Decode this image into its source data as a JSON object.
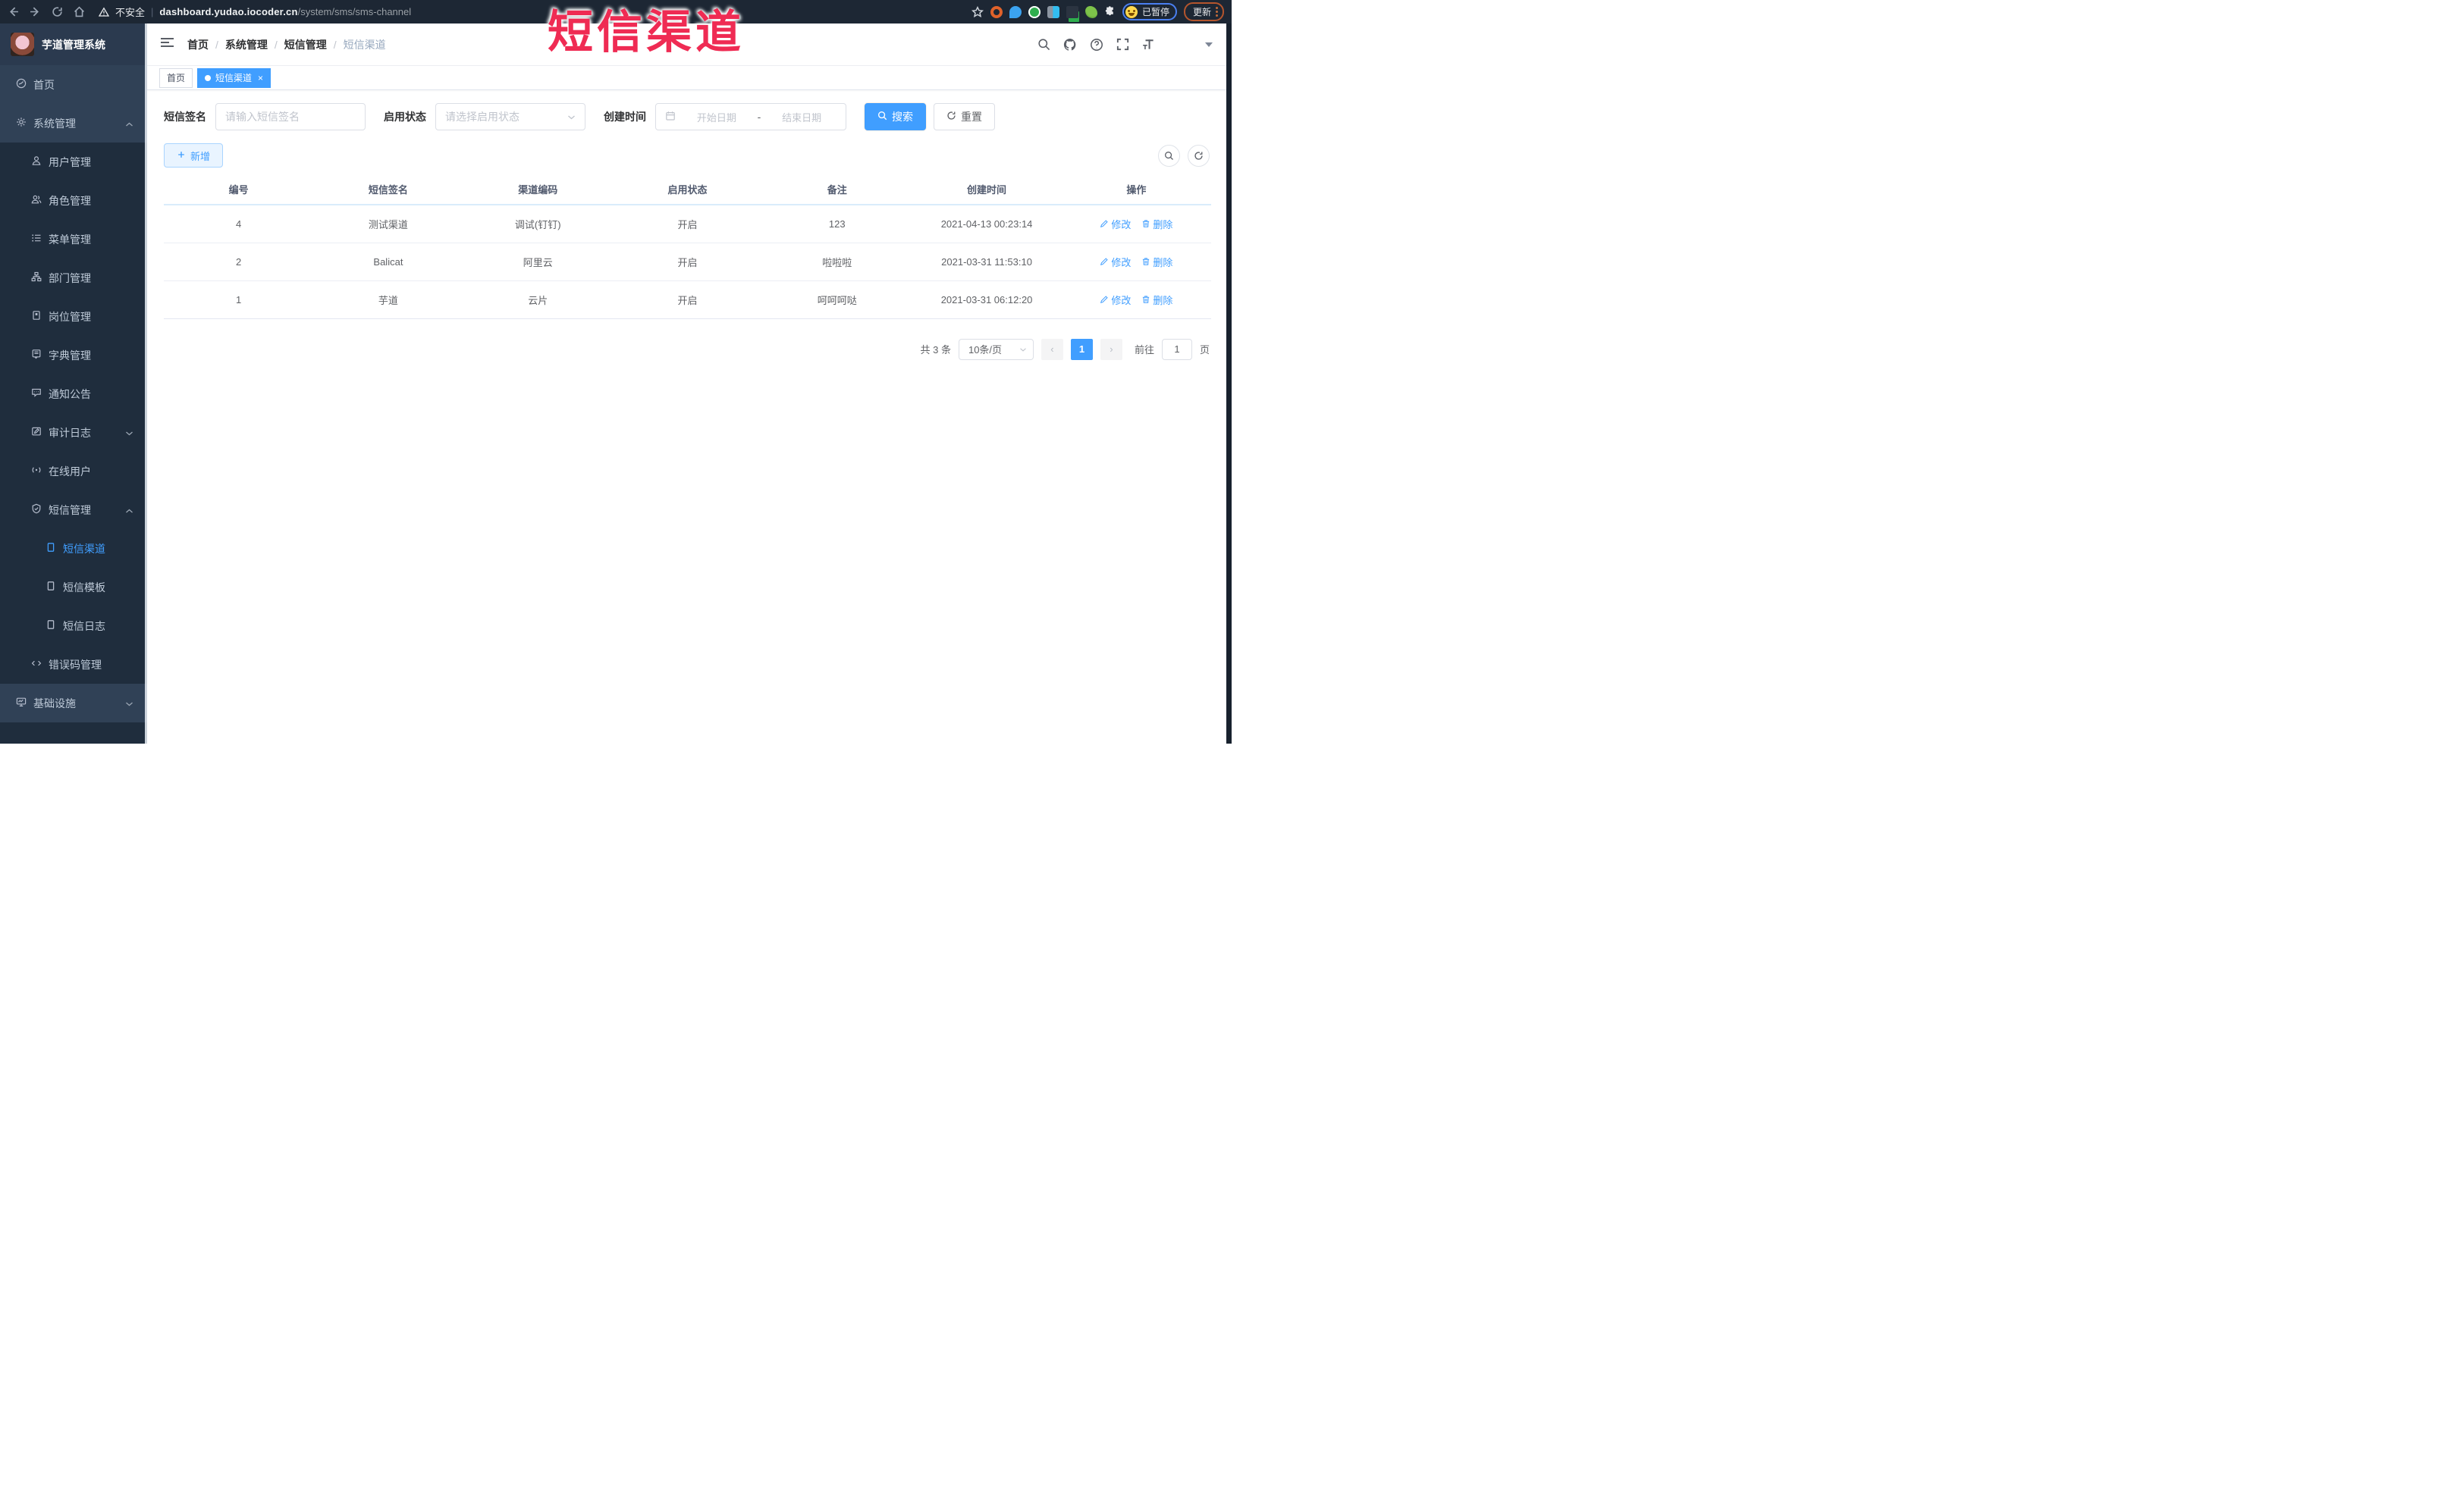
{
  "browser": {
    "security_label": "不安全",
    "url_domain": "dashboard.yudao.iocoder.cn",
    "url_path": "/system/sms/sms-channel",
    "profile_status": "已暂停",
    "update_label": "更新"
  },
  "overlay": {
    "text": "短信渠道",
    "color": "#ef2b53"
  },
  "sidebar": {
    "logo_title": "芋道管理系统",
    "menu": {
      "home": "首页",
      "system": "系统管理",
      "user": "用户管理",
      "role": "角色管理",
      "menu": "菜单管理",
      "dept": "部门管理",
      "post": "岗位管理",
      "dict": "字典管理",
      "notice": "通知公告",
      "audit": "审计日志",
      "online": "在线用户",
      "sms": "短信管理",
      "sms_channel": "短信渠道",
      "sms_template": "短信模板",
      "sms_log": "短信日志",
      "errcode": "错误码管理",
      "infra": "基础设施"
    }
  },
  "breadcrumb": {
    "b0": "首页",
    "b1": "系统管理",
    "b2": "短信管理",
    "b3": "短信渠道",
    "sep": "/"
  },
  "tabs": {
    "t0": "首页",
    "t1": "短信渠道",
    "close": "×"
  },
  "filters": {
    "sign_label": "短信签名",
    "sign_placeholder": "请输入短信签名",
    "status_label": "启用状态",
    "status_placeholder": "请选择启用状态",
    "time_label": "创建时间",
    "start_placeholder": "开始日期",
    "range_sep": "-",
    "end_placeholder": "结束日期",
    "search_label": "搜索",
    "reset_label": "重置"
  },
  "toolbar": {
    "add_label": "新增"
  },
  "table": {
    "headers": {
      "h0": "编号",
      "h1": "短信签名",
      "h2": "渠道编码",
      "h3": "启用状态",
      "h4": "备注",
      "h5": "创建时间",
      "h6": "操作"
    },
    "edit_label": "修改",
    "delete_label": "删除",
    "rows": [
      {
        "id": "4",
        "sign": "测试渠道",
        "code": "调试(钉钉)",
        "status": "开启",
        "remark": "123",
        "created": "2021-04-13 00:23:14"
      },
      {
        "id": "2",
        "sign": "Balicat",
        "code": "阿里云",
        "status": "开启",
        "remark": "啦啦啦",
        "created": "2021-03-31 11:53:10"
      },
      {
        "id": "1",
        "sign": "芋道",
        "code": "云片",
        "status": "开启",
        "remark": "呵呵呵哒",
        "created": "2021-03-31 06:12:20"
      }
    ]
  },
  "pagination": {
    "total": "共 3 条",
    "page_size": "10条/页",
    "prev": "‹",
    "page": "1",
    "next": "›",
    "goto_label": "前往",
    "goto_value": "1",
    "goto_suffix": "页"
  },
  "colors": {
    "primary": "#409eff",
    "sidebar_bg": "#304156",
    "submenu_bg": "#1f2d3d",
    "overlay_red": "#ef2b53"
  }
}
